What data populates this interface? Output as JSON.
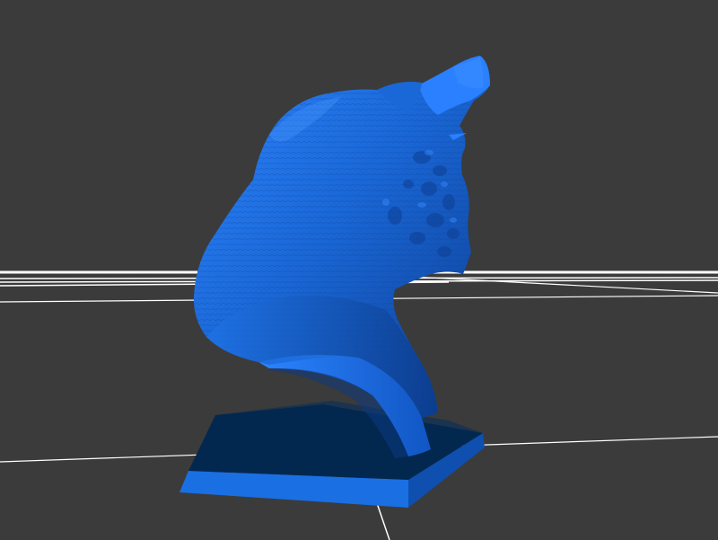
{
  "viewport": {
    "background_color": "#3b3b3b",
    "grid_color": "#ffffff",
    "model_color": "#1d6fe0",
    "model_highlight": "#3b8cff",
    "model_shadow": "#0a2d6b",
    "base_top_color": "#022a55",
    "base_side_color": "#1566d6",
    "model_name": "creature bust"
  }
}
